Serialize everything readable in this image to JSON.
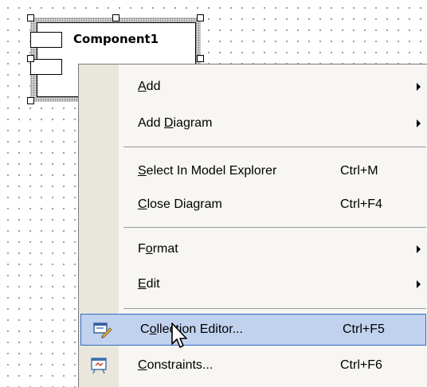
{
  "component": {
    "title": "Component1"
  },
  "menu": {
    "items": [
      {
        "id": "add",
        "pre": "",
        "mnemonic": "A",
        "post": "dd",
        "shortcut": "",
        "submenu": true
      },
      {
        "id": "add-diagram",
        "pre": "Add ",
        "mnemonic": "D",
        "post": "iagram",
        "shortcut": "",
        "submenu": true
      },
      {
        "id": "select-in-model-explorer",
        "pre": "",
        "mnemonic": "S",
        "post": "elect In Model Explorer",
        "shortcut": "Ctrl+M",
        "submenu": false
      },
      {
        "id": "close-diagram",
        "pre": "",
        "mnemonic": "C",
        "post": "lose Diagram",
        "shortcut": "Ctrl+F4",
        "submenu": false
      },
      {
        "id": "format",
        "pre": "F",
        "mnemonic": "o",
        "post": "rmat",
        "shortcut": "",
        "submenu": true
      },
      {
        "id": "edit",
        "pre": "",
        "mnemonic": "E",
        "post": "dit",
        "shortcut": "",
        "submenu": true
      },
      {
        "id": "collection-editor",
        "pre": "C",
        "mnemonic": "o",
        "post": "llection Editor...",
        "shortcut": "Ctrl+F5",
        "submenu": false,
        "icon": "collection-editor-icon",
        "highlighted": true
      },
      {
        "id": "constraints",
        "pre": "",
        "mnemonic": "C",
        "post": "onstraints...",
        "shortcut": "Ctrl+F6",
        "submenu": false,
        "icon": "constraints-icon"
      }
    ]
  },
  "colors": {
    "highlight_fill": "#c1d2ee",
    "highlight_border": "#316ac5",
    "menu_background": "#f7f6f2",
    "menu_gutter": "#e9e7dc"
  }
}
